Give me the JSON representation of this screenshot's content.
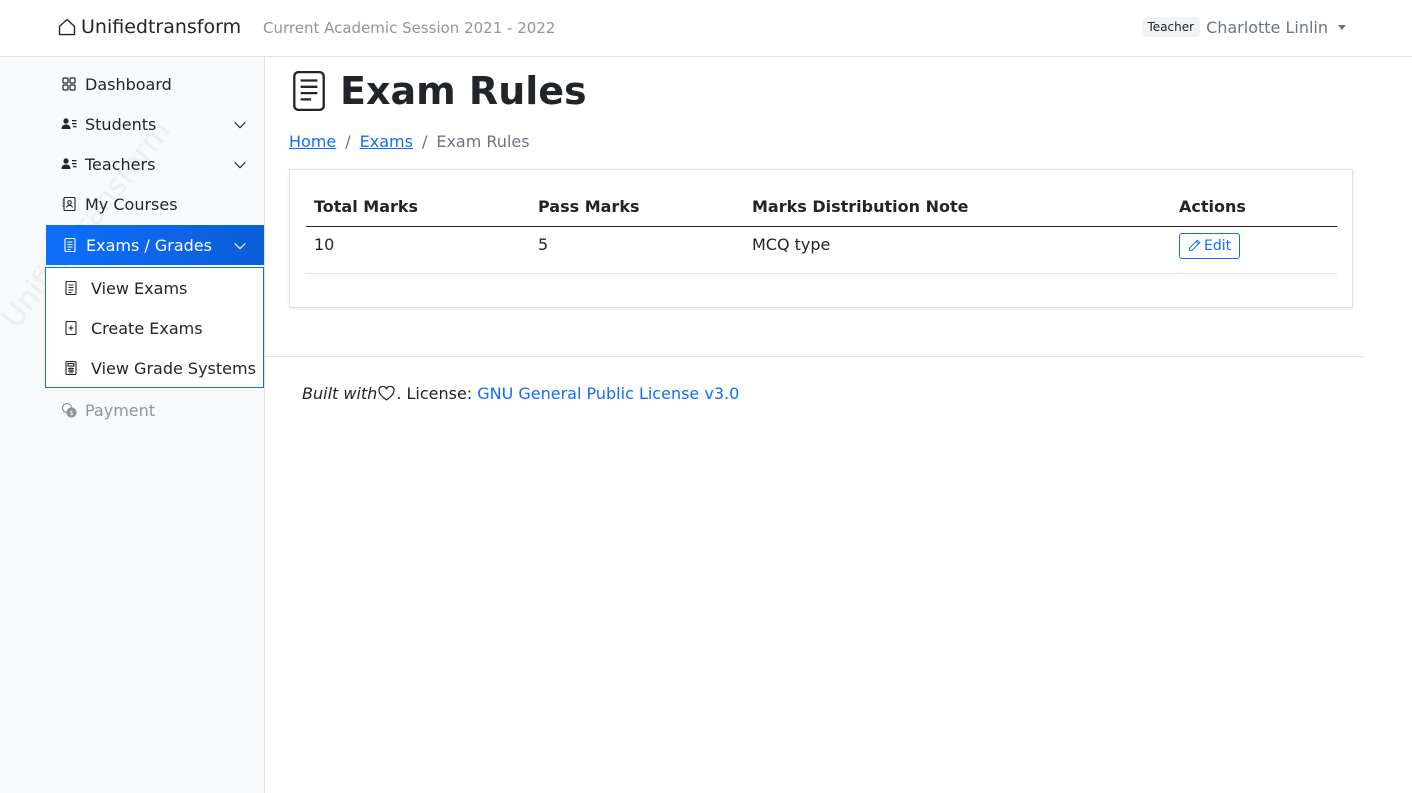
{
  "header": {
    "brand": "Unifiedtransform",
    "session": "Current Academic Session 2021 - 2022",
    "role_badge": "Teacher",
    "user_name": "Charlotte Linlin"
  },
  "sidebar": {
    "watermark": "Unifiedtransform",
    "items": [
      {
        "label": "Dashboard",
        "icon": "grid-icon"
      },
      {
        "label": "Students",
        "icon": "person-lines-icon",
        "expandable": true
      },
      {
        "label": "Teachers",
        "icon": "person-lines-icon",
        "expandable": true
      },
      {
        "label": "My Courses",
        "icon": "journal-person-icon"
      },
      {
        "label": "Exams / Grades",
        "icon": "file-text-icon",
        "expandable": true,
        "active": true
      },
      {
        "label": "Payment",
        "icon": "coins-icon",
        "disabled": true
      }
    ],
    "submenu": [
      {
        "label": "View Exams",
        "icon": "file-text-icon"
      },
      {
        "label": "Create Exams",
        "icon": "file-plus-icon"
      },
      {
        "label": "View Grade Systems",
        "icon": "calculator-icon"
      }
    ]
  },
  "page": {
    "title": "Exam Rules",
    "breadcrumb": [
      {
        "label": "Home",
        "link": true
      },
      {
        "label": "Exams",
        "link": true
      },
      {
        "label": "Exam Rules",
        "link": false
      }
    ],
    "separator": "/"
  },
  "table": {
    "headers": [
      "Total Marks",
      "Pass Marks",
      "Marks Distribution Note",
      "Actions"
    ],
    "rows": [
      {
        "total_marks": "10",
        "pass_marks": "5",
        "note": "MCQ type",
        "action": "Edit"
      }
    ]
  },
  "footer": {
    "built_with": "Built with",
    "license_prefix": ". License:",
    "license_link": "GNU General Public License v3.0"
  }
}
